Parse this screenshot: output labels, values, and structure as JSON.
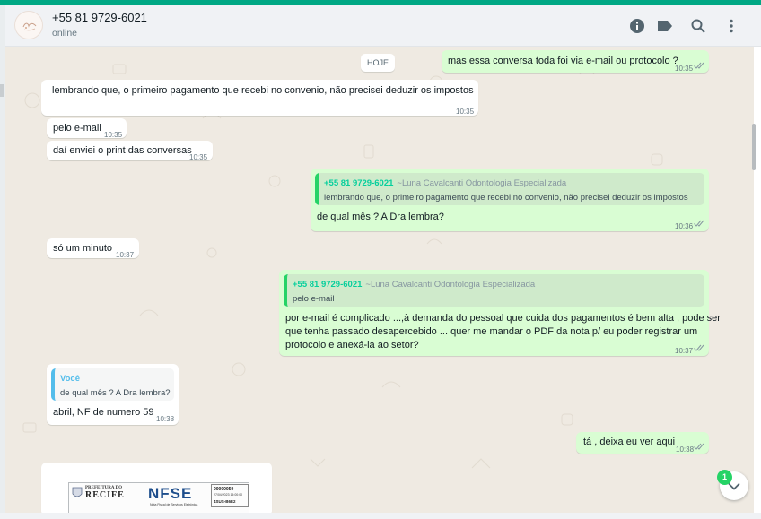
{
  "header": {
    "contact_name": "+55 81 9729-6021",
    "status": "online",
    "icons": [
      "info-icon",
      "label-icon",
      "search-icon",
      "menu-icon"
    ]
  },
  "chat": {
    "date_chip": "HOJE",
    "messages": [
      {
        "dir": "out",
        "text": "mas essa conversa toda foi via e-mail ou protocolo ?",
        "time": "10:35",
        "read": true
      },
      {
        "dir": "in",
        "text": "lembrando que, o primeiro pagamento que recebi no convenio, não precisei deduzir os impostos",
        "time": "10:35"
      },
      {
        "dir": "in",
        "text": "pelo e-mail",
        "time": "10:35"
      },
      {
        "dir": "in",
        "text": "daí enviei o print das conversas",
        "time": "10:35"
      },
      {
        "dir": "out",
        "quote": {
          "author": "+55 81 9729-6021",
          "author_sub": "~Luna Cavalcanti Odontologia Especializada",
          "text": "lembrando que, o primeiro pagamento que recebi no convenio, não precisei deduzir os impostos"
        },
        "text": "de qual mês ? A Dra lembra?",
        "time": "10:36",
        "read": true
      },
      {
        "dir": "in",
        "text": "só um minuto",
        "time": "10:37"
      },
      {
        "dir": "out",
        "quote": {
          "author": "+55 81 9729-6021",
          "author_sub": "~Luna Cavalcanti Odontologia Especializada",
          "text": "pelo e-mail"
        },
        "lines": [
          "por e-mail é complicado ...,à demanda do pessoal que cuida dos pagamentos é bem alta , pode ser",
          "que tenha passado desapercebido ... quer me mandar o PDF da nota p/ eu poder registrar um",
          "protocolo e anexá-la ao setor?"
        ],
        "time": "10:37",
        "read": true
      },
      {
        "dir": "in",
        "quote": {
          "author": "Você",
          "text": "de qual mês ? A Dra lembra?"
        },
        "text": "abril, NF de numero 59",
        "time": "10:38"
      },
      {
        "dir": "out",
        "text": "tá , deixa eu ver aqui",
        "time": "10:38",
        "read": true
      }
    ],
    "image_preview": {
      "prefeitura": "PREFEITURA DO",
      "city": "RECIFE",
      "logo": "NFSE",
      "logo_sub": "Nota Fiscal de Serviços Eletrônica",
      "number": "00000059",
      "date": "27/04/2023 15:00:00",
      "code": "4SUS-B6E2"
    },
    "unread_count": "1"
  },
  "colors": {
    "accent": "#00a884",
    "out_bubble": "#d9fdd3",
    "in_bubble": "#ffffff",
    "chat_bg": "#efeae2",
    "read_tick": "#53bdeb"
  }
}
